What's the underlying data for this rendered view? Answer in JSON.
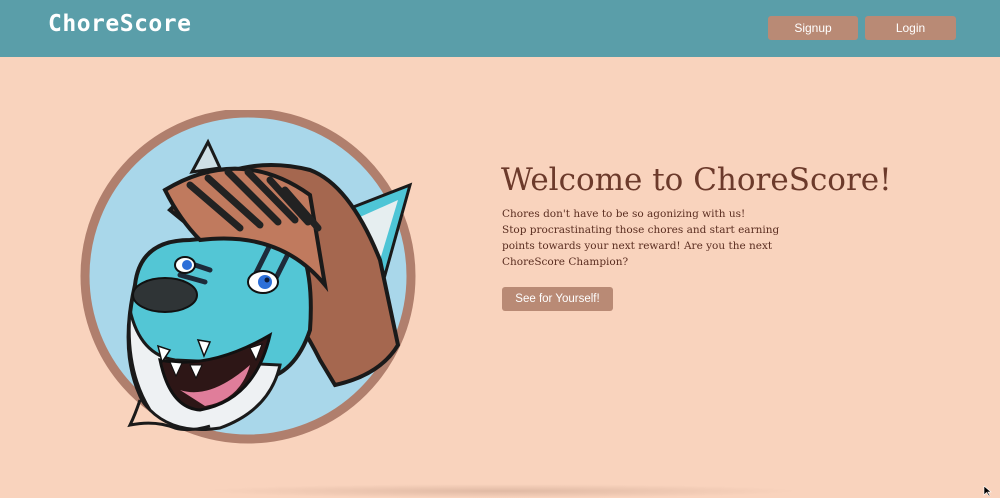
{
  "header": {
    "brand": "ChoreScore",
    "signup_label": "Signup",
    "login_label": "Login"
  },
  "hero": {
    "title": "Welcome to ChoreScore!",
    "lines": [
      "Chores don't have to be so agonizing with us!",
      "Stop procrastinating those chores and start earning",
      "points towards your next reward! Are you the next",
      "ChoreScore Champion?"
    ],
    "cta_label": "See for Yourself!"
  },
  "mascot": {
    "icon": "knight-wolf-mascot-illustration"
  },
  "colors": {
    "navbar": "#5a9ea9",
    "background": "#f9d3bd",
    "button": "#b98a75",
    "heading": "#6c3a2b",
    "circle_fill": "#a9d7ea",
    "circle_ring": "#b07f6d"
  }
}
